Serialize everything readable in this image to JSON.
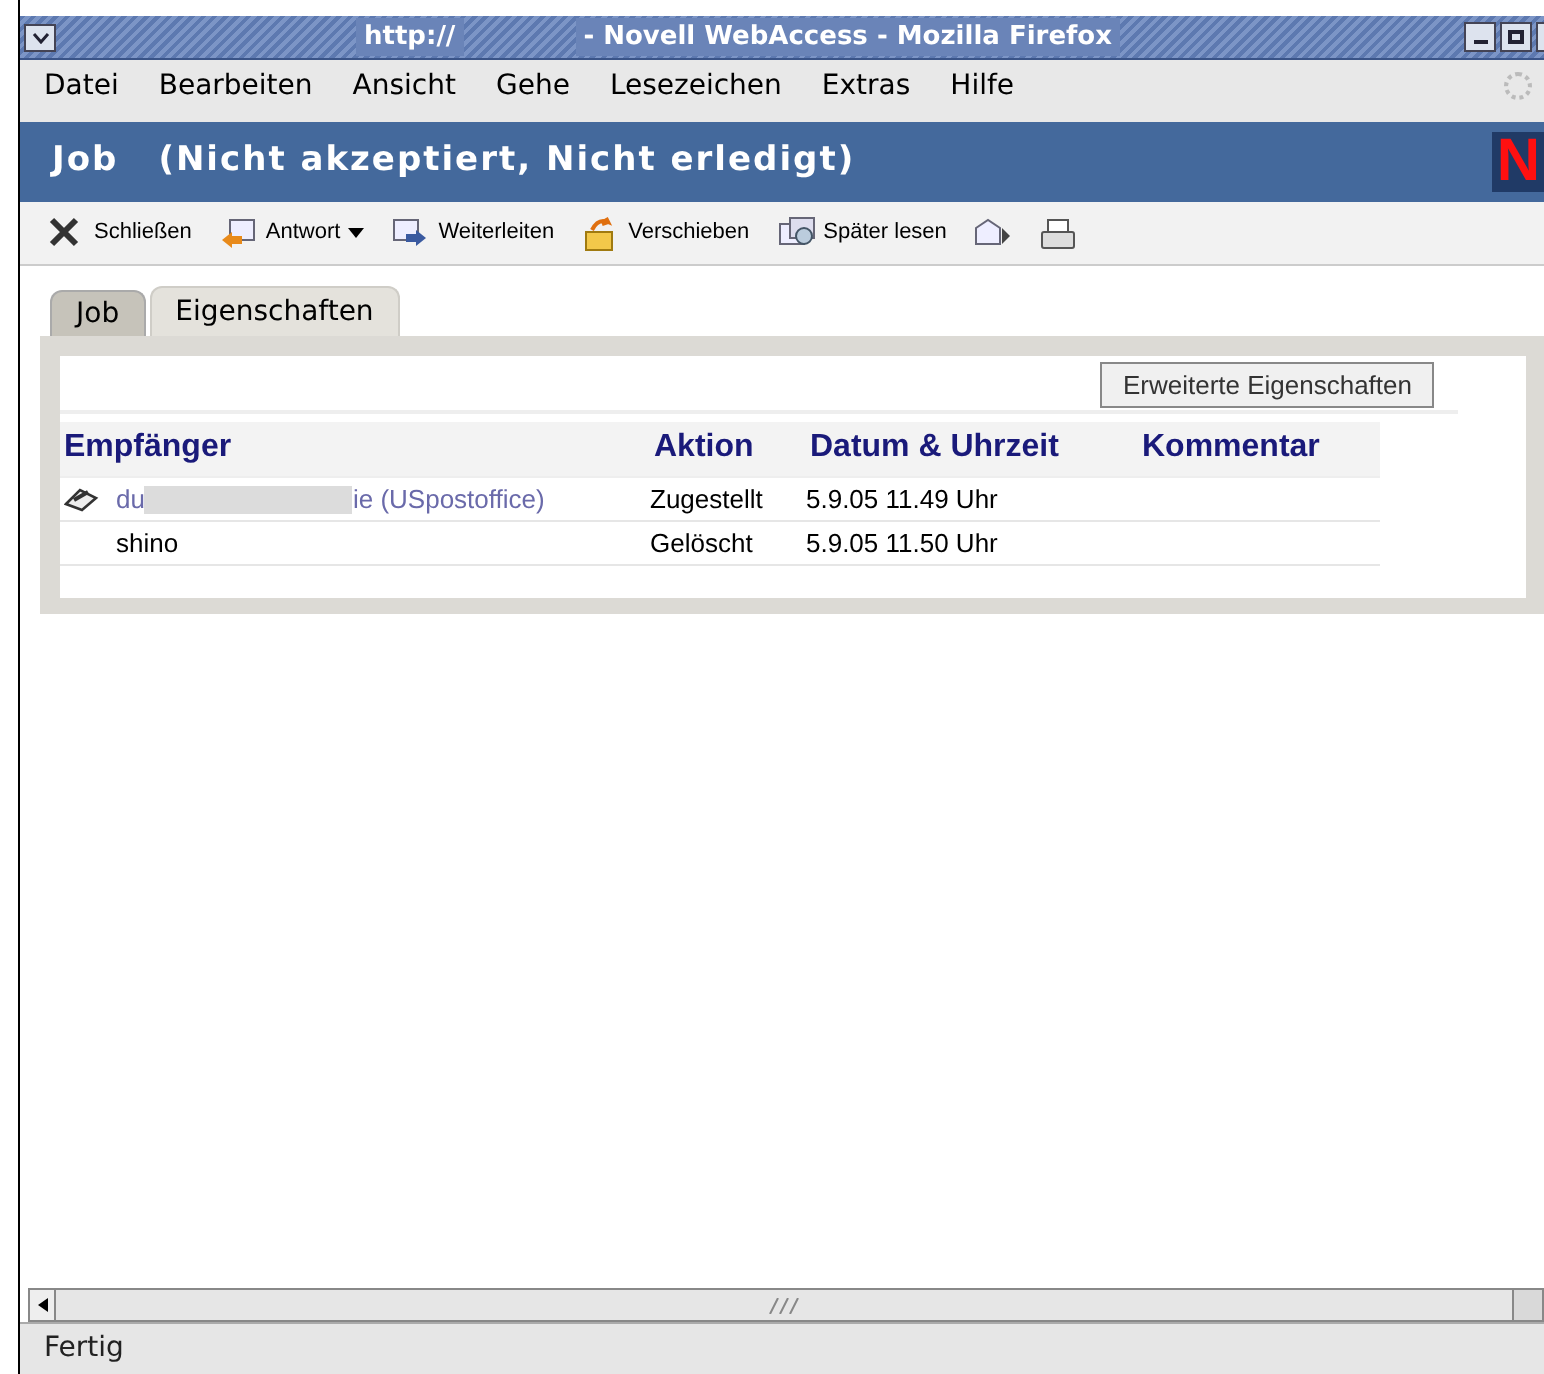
{
  "window": {
    "title_left": "http://",
    "title_right": "- Novell WebAccess - Mozilla Firefox"
  },
  "menu": [
    "Datei",
    "Bearbeiten",
    "Ansicht",
    "Gehe",
    "Lesezeichen",
    "Extras",
    "Hilfe"
  ],
  "header": {
    "title": "Job",
    "subtitle": "(Nicht akzeptiert, Nicht erledigt)",
    "logo": "N"
  },
  "toolbar": [
    {
      "kind": "close",
      "label": "Schließen"
    },
    {
      "kind": "reply",
      "label": "Antwort",
      "dropdown": true
    },
    {
      "kind": "forward",
      "label": "Weiterleiten"
    },
    {
      "kind": "move",
      "label": "Verschieben"
    },
    {
      "kind": "later",
      "label": "Später lesen"
    },
    {
      "kind": "next"
    },
    {
      "kind": "print"
    }
  ],
  "tabs": [
    {
      "label": "Job",
      "selected": false
    },
    {
      "label": "Eigenschaften",
      "selected": true
    }
  ],
  "advanced_button": "Erweiterte Eigenschaften",
  "table": {
    "columns": [
      "Empfänger",
      "Aktion",
      "Datum & Uhrzeit",
      "Kommentar"
    ],
    "rows": [
      {
        "kind": "link",
        "recipient_start": "du",
        "redacted": true,
        "recipient_end": "ie (USpostoffice)",
        "action": "Zugestellt",
        "date": "5.9.05 11.49 Uhr"
      },
      {
        "kind": "plain",
        "recipient_start": "shino",
        "redacted": false,
        "action": "Gelöscht",
        "date": "5.9.05 11.50 Uhr"
      }
    ]
  },
  "status_bar": "Fertig"
}
